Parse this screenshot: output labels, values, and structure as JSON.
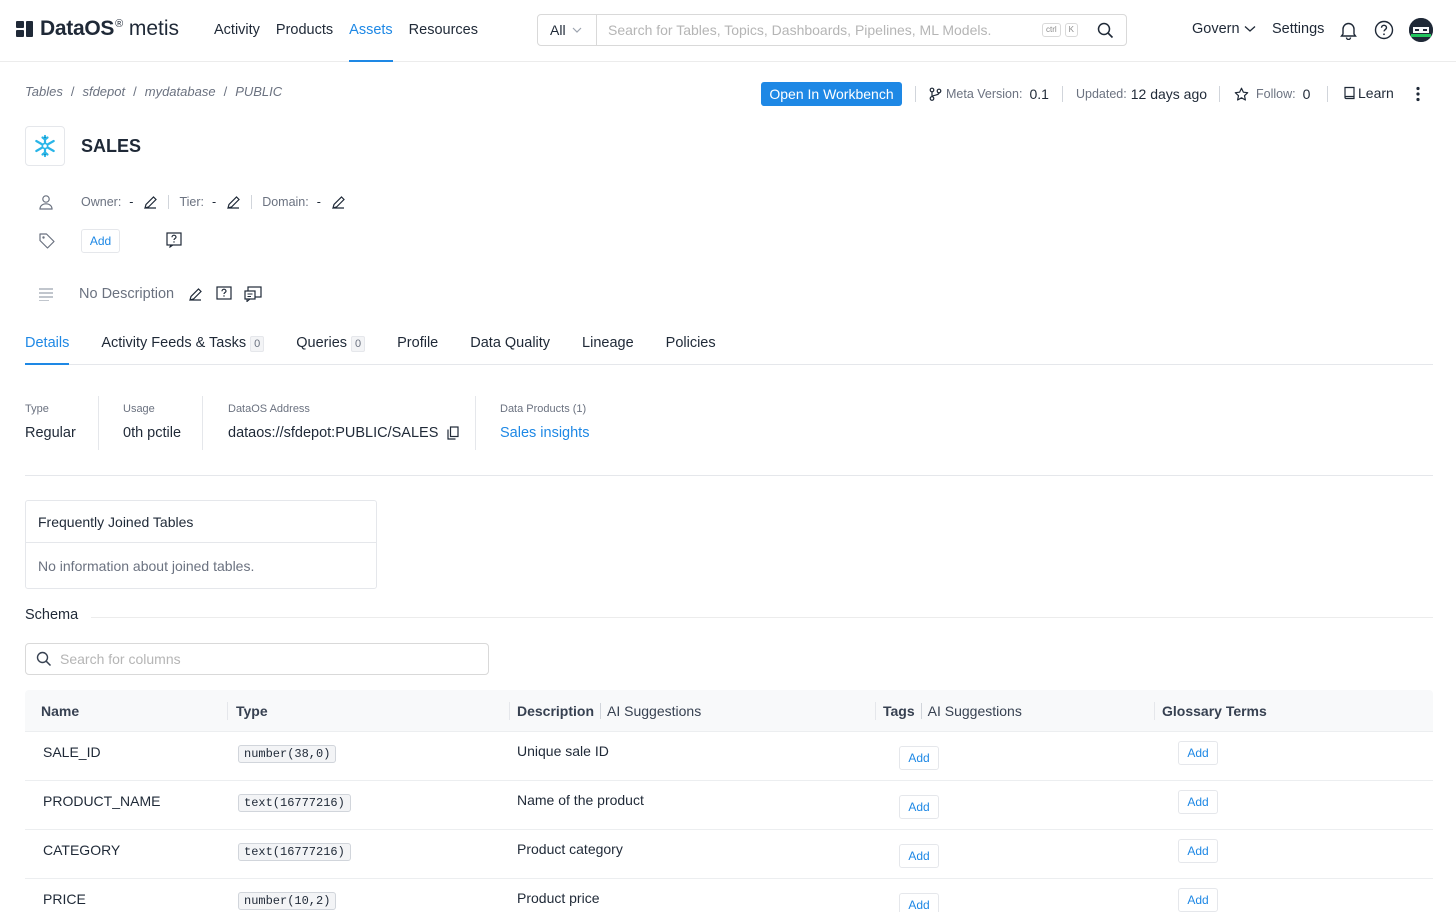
{
  "brand": {
    "name": "DataOS",
    "reg": "®",
    "product": "metis"
  },
  "nav": {
    "items": [
      {
        "label": "Activity"
      },
      {
        "label": "Products"
      },
      {
        "label": "Assets"
      },
      {
        "label": "Resources"
      }
    ],
    "active": "Assets"
  },
  "search": {
    "scope": "All",
    "placeholder": "Search for Tables, Topics, Dashboards, Pipelines, ML Models.",
    "kbd_ctrl": "ctrl",
    "kbd_k": "K"
  },
  "header_right": {
    "govern": "Govern",
    "settings": "Settings"
  },
  "breadcrumb": [
    "Tables",
    "sfdepot",
    "mydatabase",
    "PUBLIC"
  ],
  "actions": {
    "workbench": "Open In Workbench",
    "meta_version_label": "Meta Version:",
    "meta_version": "0.1",
    "updated_label": "Updated:",
    "updated": "12 days ago",
    "follow_label": "Follow:",
    "follow_count": "0",
    "learn": "Learn"
  },
  "entity": {
    "title": "SALES"
  },
  "owner_row": {
    "owner_label": "Owner:",
    "owner": "-",
    "tier_label": "Tier:",
    "tier": "-",
    "domain_label": "Domain:",
    "domain": "-"
  },
  "tags": {
    "add": "Add"
  },
  "description": {
    "text": "No Description"
  },
  "tabs": [
    {
      "label": "Details",
      "count": ""
    },
    {
      "label": "Activity Feeds & Tasks",
      "count": "0"
    },
    {
      "label": "Queries",
      "count": "0"
    },
    {
      "label": "Profile",
      "count": ""
    },
    {
      "label": "Data Quality",
      "count": ""
    },
    {
      "label": "Lineage",
      "count": ""
    },
    {
      "label": "Policies",
      "count": ""
    }
  ],
  "details": {
    "type_label": "Type",
    "type": "Regular",
    "usage_label": "Usage",
    "usage": "0th pctile",
    "address_label": "DataOS Address",
    "address": "dataos://sfdepot:PUBLIC/SALES",
    "products_label": "Data Products (1)",
    "product": "Sales insights"
  },
  "joined": {
    "title": "Frequently Joined Tables",
    "empty": "No information about joined tables."
  },
  "schema": {
    "title": "Schema",
    "search_placeholder": "Search for columns",
    "headers": {
      "name": "Name",
      "type": "Type",
      "description": "Description",
      "ai1": "AI Suggestions",
      "tags": "Tags",
      "ai2": "AI Suggestions",
      "glossary": "Glossary Terms"
    },
    "add": "Add",
    "rows": [
      {
        "name": "SALE_ID",
        "type": "number(38,0)",
        "description": "Unique sale ID"
      },
      {
        "name": "PRODUCT_NAME",
        "type": "text(16777216)",
        "description": "Name of the product"
      },
      {
        "name": "CATEGORY",
        "type": "text(16777216)",
        "description": "Product category"
      },
      {
        "name": "PRICE",
        "type": "number(10,2)",
        "description": "Product price"
      }
    ]
  },
  "colors": {
    "accent": "#1e88e5",
    "text": "#1f2937",
    "muted": "#6b7280",
    "snowflake": "#29b5e8"
  }
}
